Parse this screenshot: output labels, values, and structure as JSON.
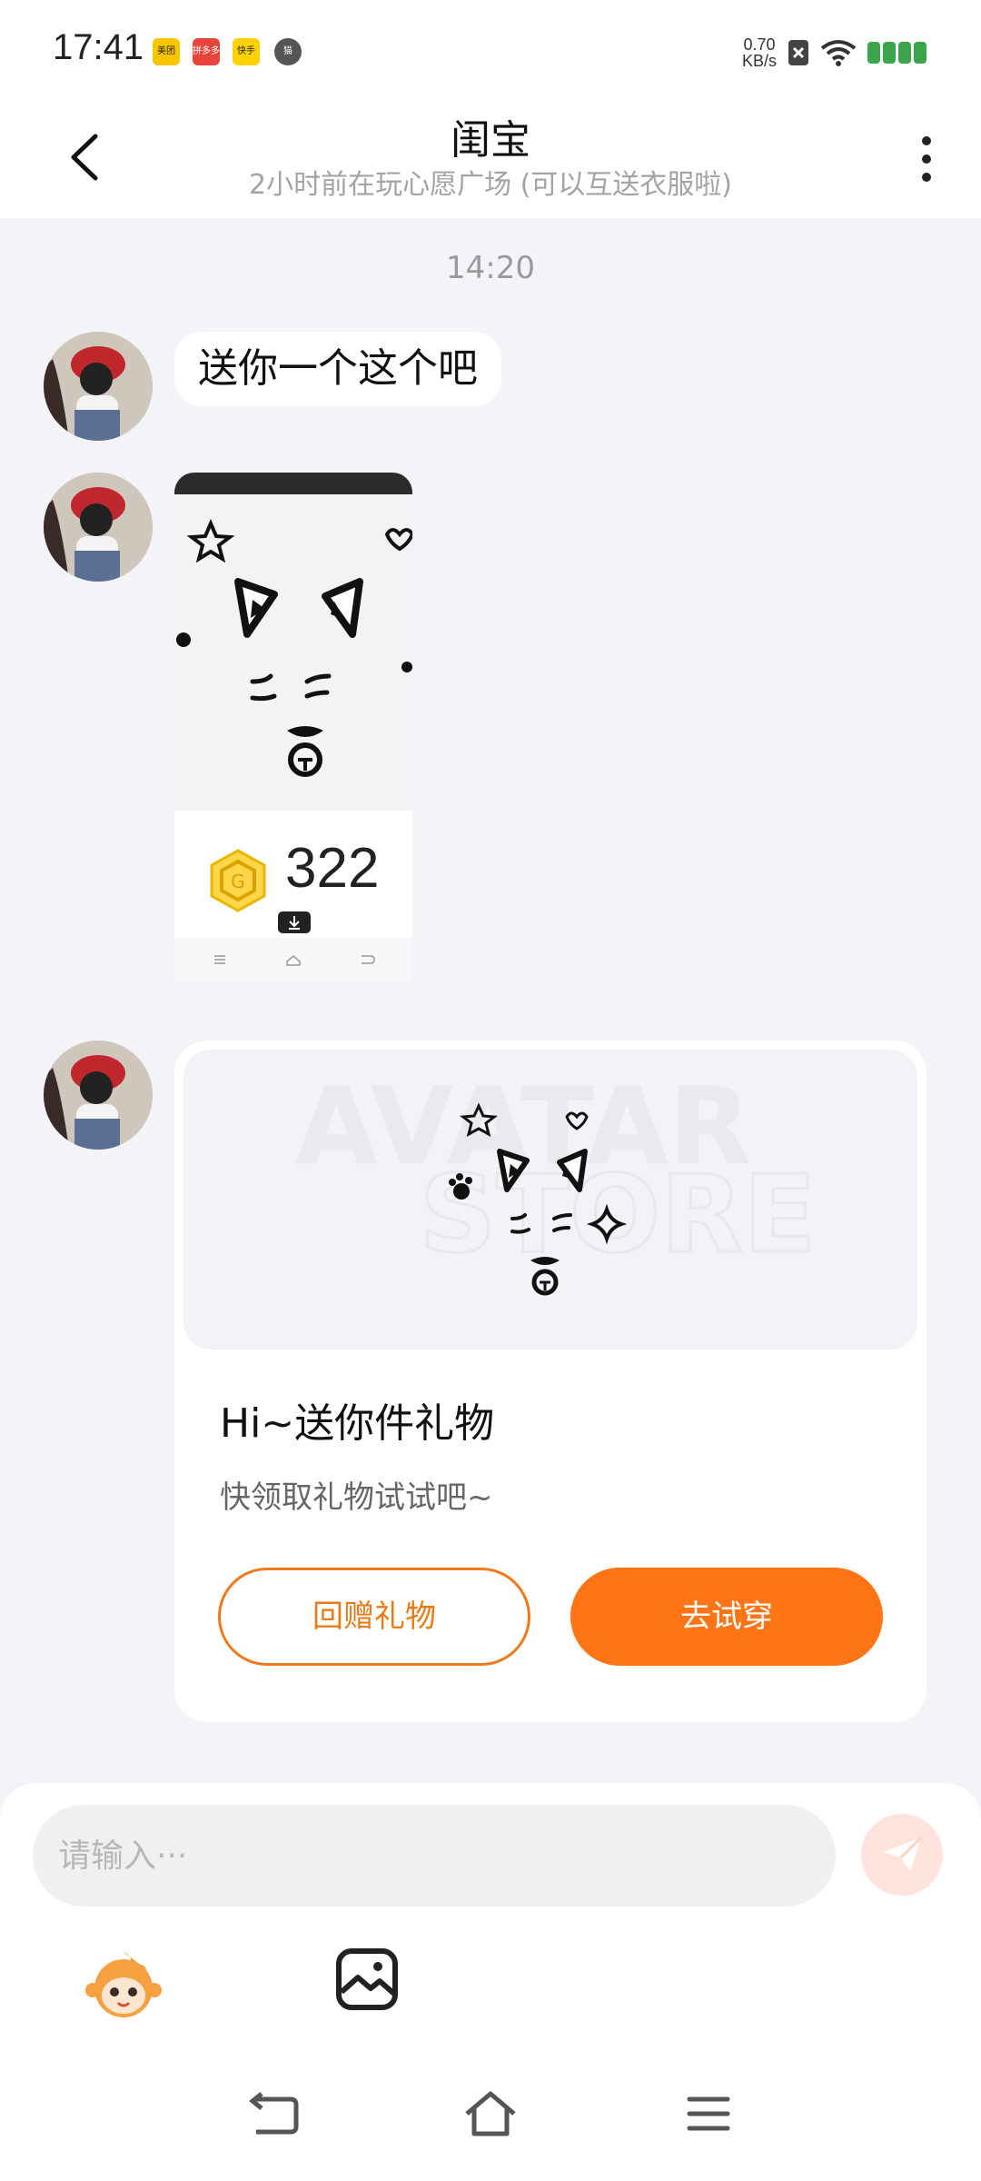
{
  "status_bar": {
    "time": "17:41",
    "net_speed_value": "0.70",
    "net_speed_unit": "KB/s",
    "apps": [
      "美团",
      "拼多多",
      "快手",
      "猫"
    ]
  },
  "header": {
    "title": "闺宝",
    "subtitle": "2小时前在玩心愿广场 (可以互送衣服啦)"
  },
  "chat": {
    "timestamp": "14:20",
    "messages": [
      {
        "type": "text",
        "text": "送你一个这个吧"
      },
      {
        "type": "image",
        "coin_count": "322"
      },
      {
        "type": "gift_card",
        "watermark_line1": "AVATAR",
        "watermark_line2": "STORE",
        "title": "Hi~送你件礼物",
        "subtitle": "快领取礼物试试吧~",
        "return_button": "回赠礼物",
        "try_button": "去试穿"
      }
    ]
  },
  "composer": {
    "placeholder": "请输入···"
  },
  "colors": {
    "accent": "#ff7414",
    "accent_outline": "#f07a1a",
    "chat_bg": "#f2f4f8",
    "send_disabled": "#ffe3dc"
  }
}
